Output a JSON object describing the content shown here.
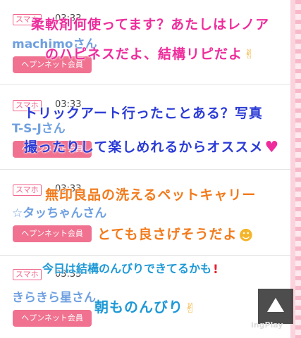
{
  "posts": [
    {
      "tag": "スマホ",
      "time": "03:33",
      "user": "machimoさん",
      "member": "ヘプンネット会員"
    },
    {
      "tag": "スマホ",
      "time": "03:33",
      "user": "T-S-Jさん",
      "member": "ヘプンネット会員"
    },
    {
      "tag": "スマホ",
      "time": "03:33",
      "user": "☆タッちゃんさん",
      "member": "ヘプンネット会員"
    },
    {
      "tag": "スマホ",
      "time": "03:33",
      "user": "きらきら星さん",
      "member": "ヘプンネット会員"
    }
  ],
  "captions": [
    "柔軟剤何使ってます？あたしはレノア",
    "のハピネスだよ、結構リピだよ",
    "トリックアート行ったことある？写真",
    "撮ったりして楽しめれるからオススメ",
    "無印良品の洗えるペットキャリー",
    "とても良さげそうだよ",
    "今日は結構のんびりできてるかも",
    "朝ものんびり"
  ],
  "watermark": "ingPlay",
  "colors": {
    "pink": "#ee2c9c",
    "blue": "#2b3bd6",
    "orange": "#f27a1b",
    "cyan": "#1e99d6",
    "button": "#f07290",
    "user": "#6fa0e0"
  }
}
